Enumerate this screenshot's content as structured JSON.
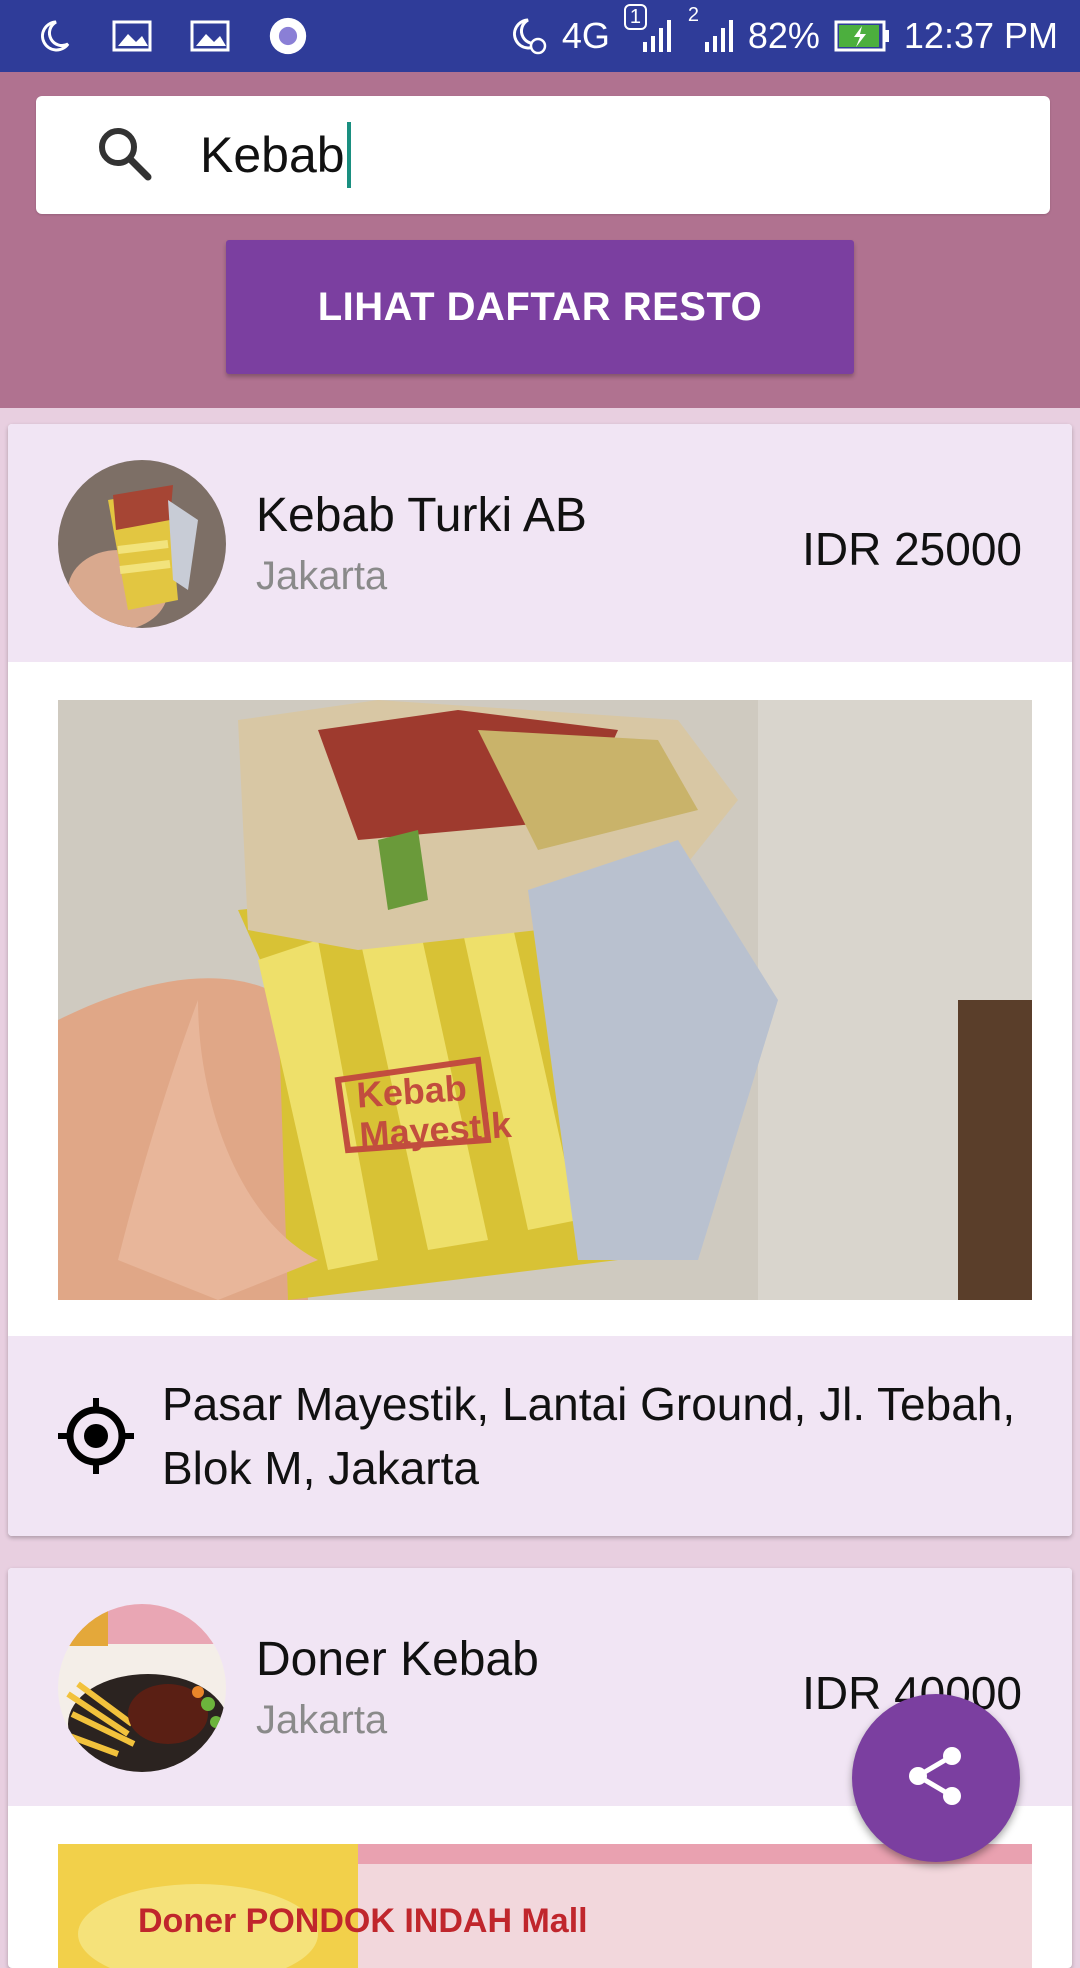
{
  "status_bar": {
    "network": "4G",
    "sim1_label": "1",
    "sim2_label": "2",
    "battery": "82%",
    "time": "12:37 PM"
  },
  "search": {
    "value": "Kebab",
    "icon": "search-icon"
  },
  "header": {
    "button_label": "LIHAT DAFTAR RESTO"
  },
  "results": [
    {
      "name": "Kebab Turki AB",
      "city": "Jakarta",
      "price": "IDR 25000",
      "photo_text": "Kebab Mayestik",
      "address": "Pasar Mayestik, Lantai Ground, Jl. Tebah, Blok M, Jakarta"
    },
    {
      "name": "Doner Kebab",
      "city": "Jakarta",
      "price": "IDR 40000",
      "photo_text": "Doner PONDOK INDAH Mall"
    }
  ],
  "fab": {
    "icon": "share-icon"
  },
  "colors": {
    "status_bar": "#2f3c99",
    "header_bg": "#b07290",
    "accent": "#7b3fa0",
    "card_head": "#f1e5f4"
  }
}
